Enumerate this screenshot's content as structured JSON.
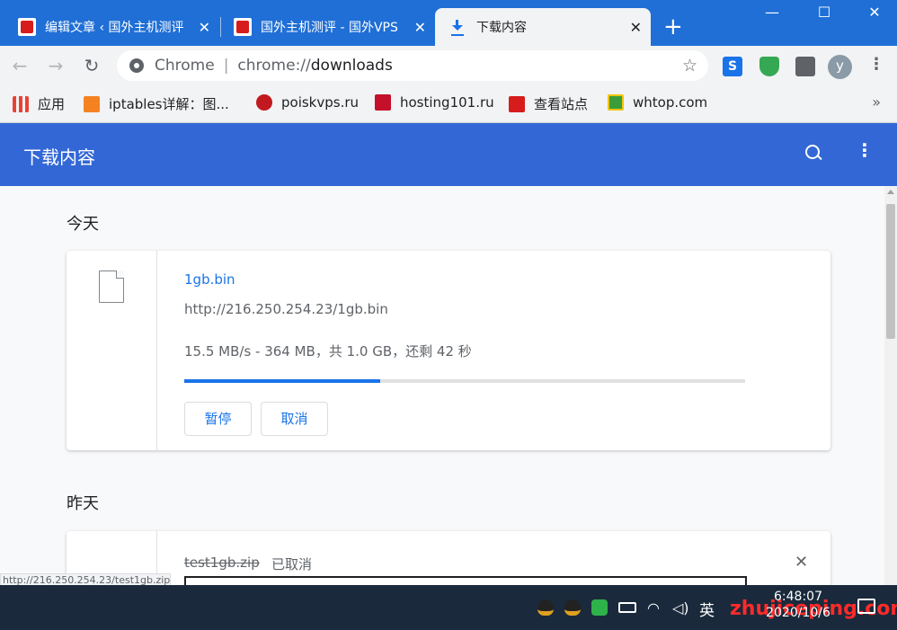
{
  "tabs": [
    {
      "title": "编辑文章 ‹ 国外主机测评",
      "close": "✕"
    },
    {
      "title": "国外主机测评 - 国外VPS",
      "close": "✕"
    },
    {
      "title": "下载内容",
      "close": "✕"
    }
  ],
  "new_tab": "+",
  "window_controls": {
    "minimize": "—",
    "maximize": "☐",
    "close": "✕"
  },
  "toolbar": {
    "back": "←",
    "forward": "→",
    "reload": "↻",
    "omnibox_scheme": "Chrome",
    "omnibox_sep": "|",
    "omnibox_url_prefix": "chrome://",
    "omnibox_url_host": "downloads",
    "star": "☆",
    "ext_s": "S",
    "avatar": "y",
    "menu": "⋮"
  },
  "bookmarks": [
    {
      "label": "应用",
      "color": "#e94235"
    },
    {
      "label": "iptables详解：图...",
      "color": "#f58220"
    },
    {
      "label": "poiskvps.ru",
      "color": "#c2181f"
    },
    {
      "label": "hosting101.ru",
      "color": "#c4102a"
    },
    {
      "label": "查看站点",
      "color": "#d71c1c"
    },
    {
      "label": "whtop.com",
      "color": "#3a9d3a"
    }
  ],
  "bookmarks_more": "»",
  "downloads": {
    "title": "下载内容",
    "menu": "⋮",
    "today_label": "今天",
    "yesterday_label": "昨天",
    "active": {
      "file_name": "1gb.bin",
      "url": "http://216.250.254.23/1gb.bin",
      "status": "15.5 MB/s - 364 MB，共 1.0 GB，还剩 42 秒",
      "progress": 0.35,
      "pause_label": "暂停",
      "cancel_label": "取消"
    },
    "cancelled": {
      "file_name": "test1gb.zip",
      "status": "已取消",
      "remove": "✕"
    }
  },
  "status_url": "http://216.250.254.23/test1gb.zip",
  "taskbar": {
    "ime": "英",
    "time": "6:48:07",
    "date": "2020/10/6",
    "watermark": "zhujiceping.com"
  },
  "colors": {
    "tab_strip": "#1f6fd6",
    "header": "#3367d6",
    "accent": "#1a73e8"
  }
}
